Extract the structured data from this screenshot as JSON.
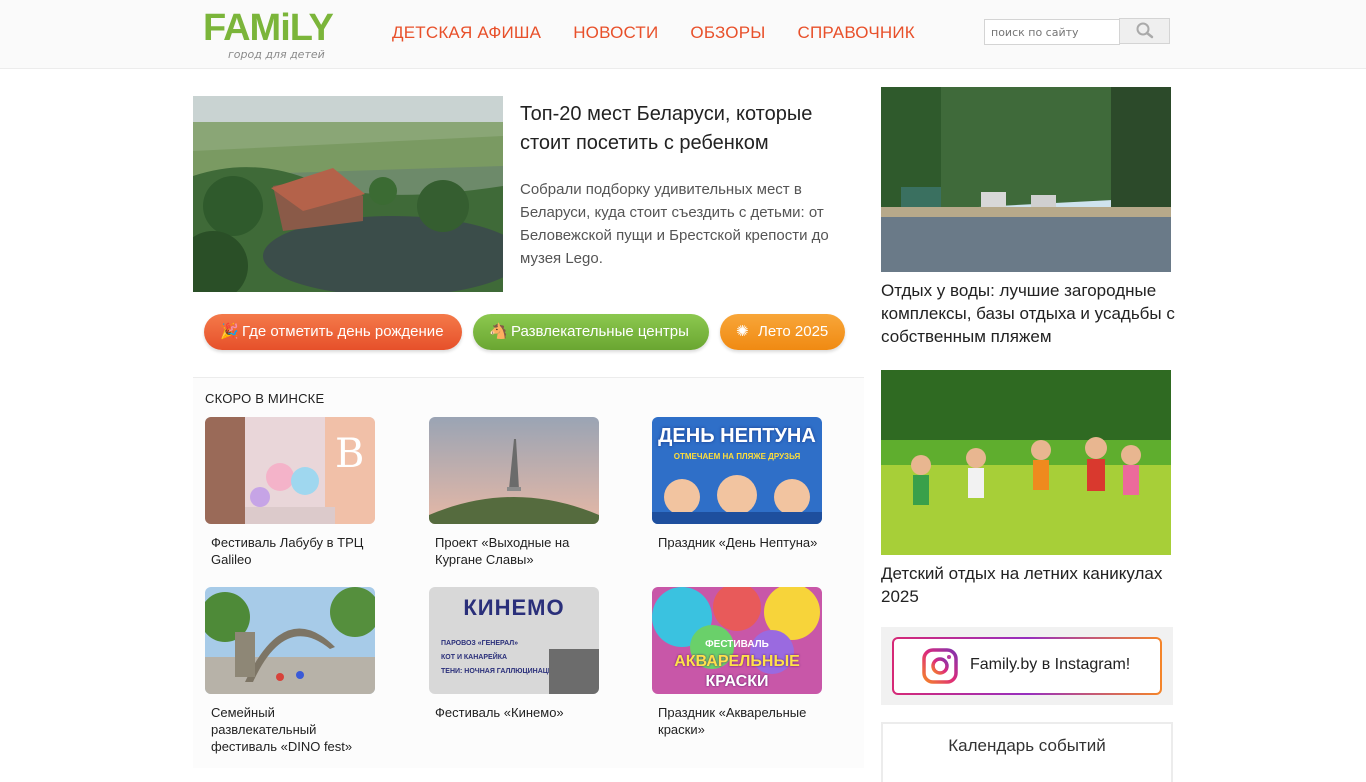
{
  "header": {
    "logo_word": "FAMiLY",
    "logo_tagline": "город для детей",
    "nav": [
      "ДЕТСКАЯ АФИША",
      "НОВОСТИ",
      "ОБЗОРЫ",
      "СПРАВОЧНИК"
    ],
    "search_placeholder": "поиск по сайту"
  },
  "featured": {
    "title": "Топ-20 мест Беларуси, которые стоит посетить с ребенком",
    "text": "Собрали подборку удивительных мест в Беларуси, куда стоит съездить с детьми: от Беловежской пущи и Брестской крепости до музея Lego."
  },
  "pills": [
    {
      "label": "Где отметить день рождение",
      "icon": "party-popper-icon",
      "color": "#e8502a"
    },
    {
      "label": "Развлекательные центры",
      "icon": "rocking-horse-icon",
      "color": "#6aa631"
    },
    {
      "label": "Лето 2025",
      "icon": "sun-icon",
      "color": "#f08a12"
    }
  ],
  "soon": {
    "title": "СКОРО В МИНСКЕ",
    "cards": [
      {
        "caption": "Фестиваль Лабубу в ТРЦ Galileo"
      },
      {
        "caption": "Проект «Выходные на Кургане Славы»"
      },
      {
        "caption": "Праздник «День Нептуна»",
        "poster_title": "ДЕНЬ НЕПТУНА",
        "poster_sub": "ОТМЕЧАЕМ НА ПЛЯЖЕ ДРУЗЬЯ"
      },
      {
        "caption": "Семейный развлекательный фестиваль «DINO fest»"
      },
      {
        "caption": "Фестиваль «Кинемо»",
        "poster_title": "КИНЕМО",
        "poster_lines": [
          "ПАРОВОЗ «ГЕНЕРАЛ»",
          "КОТ И КАНАРЕЙКА",
          "ТЕНИ: НОЧНАЯ ГАЛЛЮЦИНАЦИЯ"
        ]
      },
      {
        "caption": "Праздник «Акварельные краски»",
        "poster_title": "ФЕСТИВАЛЬ",
        "poster_sub1": "АКВАРЕЛЬНЫЕ",
        "poster_sub2": "КРАСКИ"
      }
    ]
  },
  "sidebar": {
    "articles": [
      {
        "title": "Отдых у воды: лучшие загородные комплексы, базы отдыха и усадьбы с собственным пляжем"
      },
      {
        "title": "Детский отдых на летних каникулах 2025"
      }
    ],
    "instagram_label": "Family.by в Instagram!",
    "calendar_title": "Календарь событий"
  },
  "colors": {
    "accent_orange": "#e8502a",
    "logo_green": "#7bb53a",
    "pill_green": "#6aa631",
    "pill_yellow": "#f08a12"
  }
}
